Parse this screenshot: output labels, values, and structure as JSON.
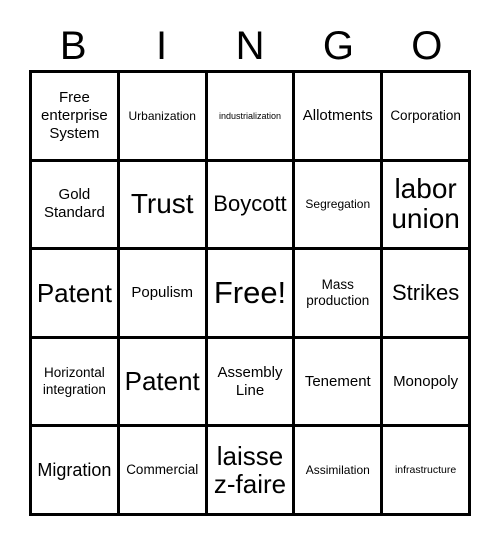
{
  "card": {
    "header_letters": [
      "B",
      "I",
      "N",
      "G",
      "O"
    ],
    "rows": [
      [
        {
          "text": "Free enterprise System",
          "size": "ml"
        },
        {
          "text": "Urbanization",
          "size": "s"
        },
        {
          "text": "industrialization",
          "size": "xxs"
        },
        {
          "text": "Allotments",
          "size": "ml"
        },
        {
          "text": "Corporation",
          "size": "m"
        }
      ],
      [
        {
          "text": "Gold Standard",
          "size": "ml"
        },
        {
          "text": "Trust",
          "size": "h1"
        },
        {
          "text": "Boycott",
          "size": "xl"
        },
        {
          "text": "Segregation",
          "size": "s"
        },
        {
          "text": "labor union",
          "size": "h1"
        }
      ],
      [
        {
          "text": "Patent",
          "size": "xxl"
        },
        {
          "text": "Populism",
          "size": "ml"
        },
        {
          "text": "Free!",
          "size": "h2"
        },
        {
          "text": "Mass production",
          "size": "m"
        },
        {
          "text": "Strikes",
          "size": "xl"
        }
      ],
      [
        {
          "text": "Horizontal integration",
          "size": "m"
        },
        {
          "text": "Patent",
          "size": "xxl"
        },
        {
          "text": "Assembly Line",
          "size": "ml"
        },
        {
          "text": "Tenement",
          "size": "ml"
        },
        {
          "text": "Monopoly",
          "size": "ml"
        }
      ],
      [
        {
          "text": "Migration",
          "size": "l"
        },
        {
          "text": "Commercial",
          "size": "m"
        },
        {
          "text": "laissez-faire",
          "size": "xxl"
        },
        {
          "text": "Assimilation",
          "size": "s"
        },
        {
          "text": "infrastructure",
          "size": "xs"
        }
      ]
    ],
    "colors": {
      "background": "#ffffff",
      "text": "#000000",
      "grid_line": "#000000"
    }
  }
}
